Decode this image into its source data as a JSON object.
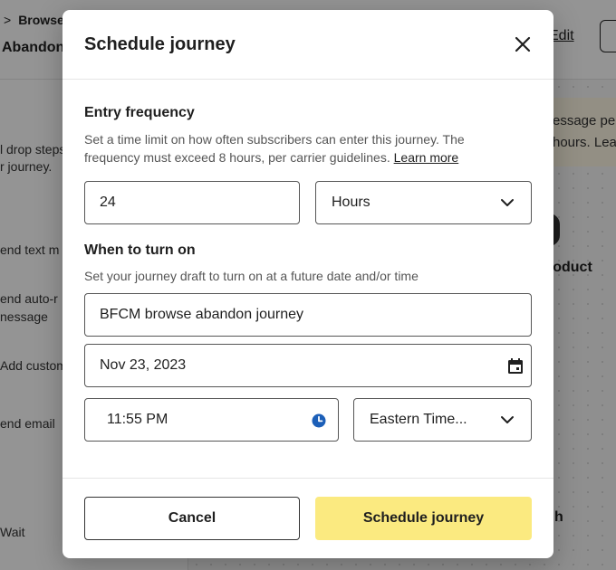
{
  "background": {
    "breadcrumb": "Browse",
    "page_title": "Abandon",
    "edit_link": "Edit",
    "sidebar_lines": [
      "l drop steps",
      "r journey.",
      "end text m",
      "end auto-r",
      "nessage",
      "Add custom",
      "end email",
      "Wait"
    ],
    "note_lines": [
      "essage pe",
      "hours. Lea"
    ],
    "product_label": "roduct",
    "canvas_letter": "h"
  },
  "modal": {
    "title": "Schedule journey",
    "entry_frequency": {
      "title": "Entry frequency",
      "helper": "Set a time limit on how often subscribers can enter this journey. The frequency must exceed 8 hours, per carrier guidelines.",
      "learn_more": "Learn more",
      "amount_value": "24",
      "unit_value": "Hours"
    },
    "when_to_turn_on": {
      "title": "When to turn on",
      "helper": "Set your journey draft to turn on at a future date and/or time",
      "name_value": "BFCM browse abandon journey",
      "date_value": "Nov 23, 2023",
      "time_value": "11:55 PM",
      "timezone_value": "Eastern Time..."
    },
    "cancel_label": "Cancel",
    "submit_label": "Schedule journey"
  },
  "colors": {
    "primary_button": "#fbea80",
    "clock_icon": "#1c5fb8",
    "overlay": "rgba(0,0,0,0.42)"
  },
  "icons": [
    "close-icon",
    "chevron-down-icon",
    "calendar-icon",
    "clock-icon"
  ]
}
